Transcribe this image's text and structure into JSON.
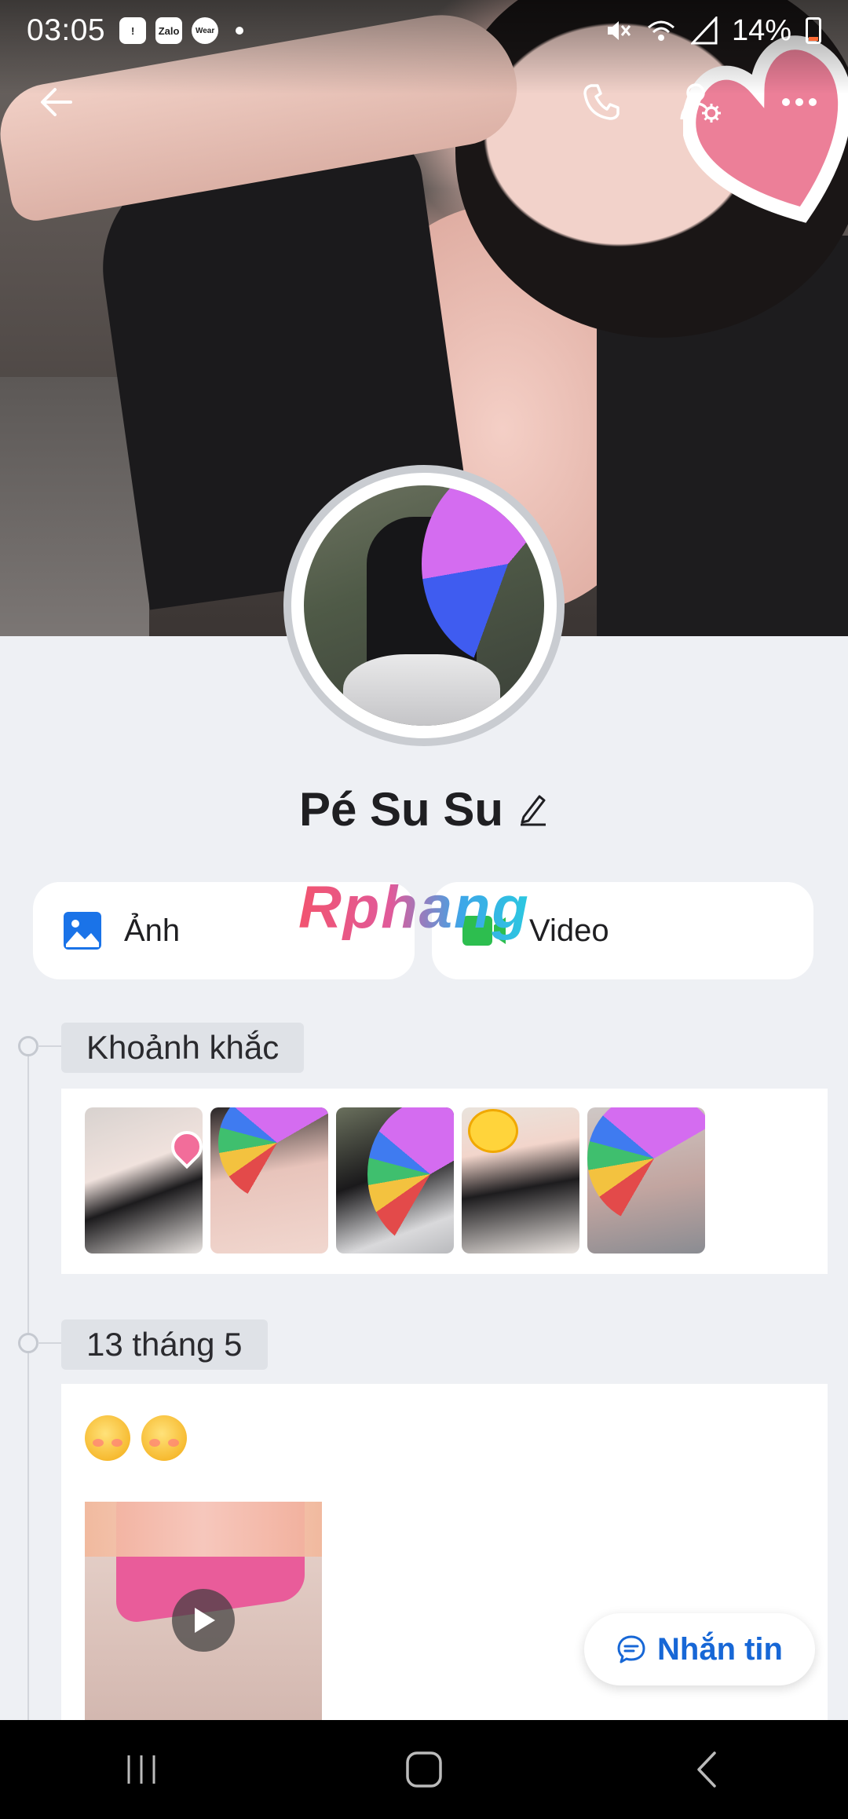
{
  "status_bar": {
    "time": "03:05",
    "notif_badges": [
      "!",
      "Zalo",
      "Wear"
    ],
    "battery": "14%"
  },
  "top_nav": {
    "back_icon": "arrow-left-icon",
    "call_icon": "phone-icon",
    "settings_icon": "user-settings-icon",
    "more_icon": "more-horizontal-icon"
  },
  "profile": {
    "name": "Pé Su Su",
    "edit_icon": "pencil-icon"
  },
  "media": {
    "photo_label": "Ảnh",
    "video_label": "Video",
    "photo_color": "#1a73e8",
    "video_color": "#2dbe4f"
  },
  "watermark": "Rphang",
  "moments": {
    "title": "Khoảnh khắc",
    "count": 5
  },
  "post": {
    "date": "13 tháng 5",
    "emojis": [
      "😘",
      "😘"
    ]
  },
  "message_button": {
    "label": "Nhắn tin",
    "color": "#1767d6"
  },
  "android_nav": [
    "recents-icon",
    "home-icon",
    "back-icon"
  ]
}
